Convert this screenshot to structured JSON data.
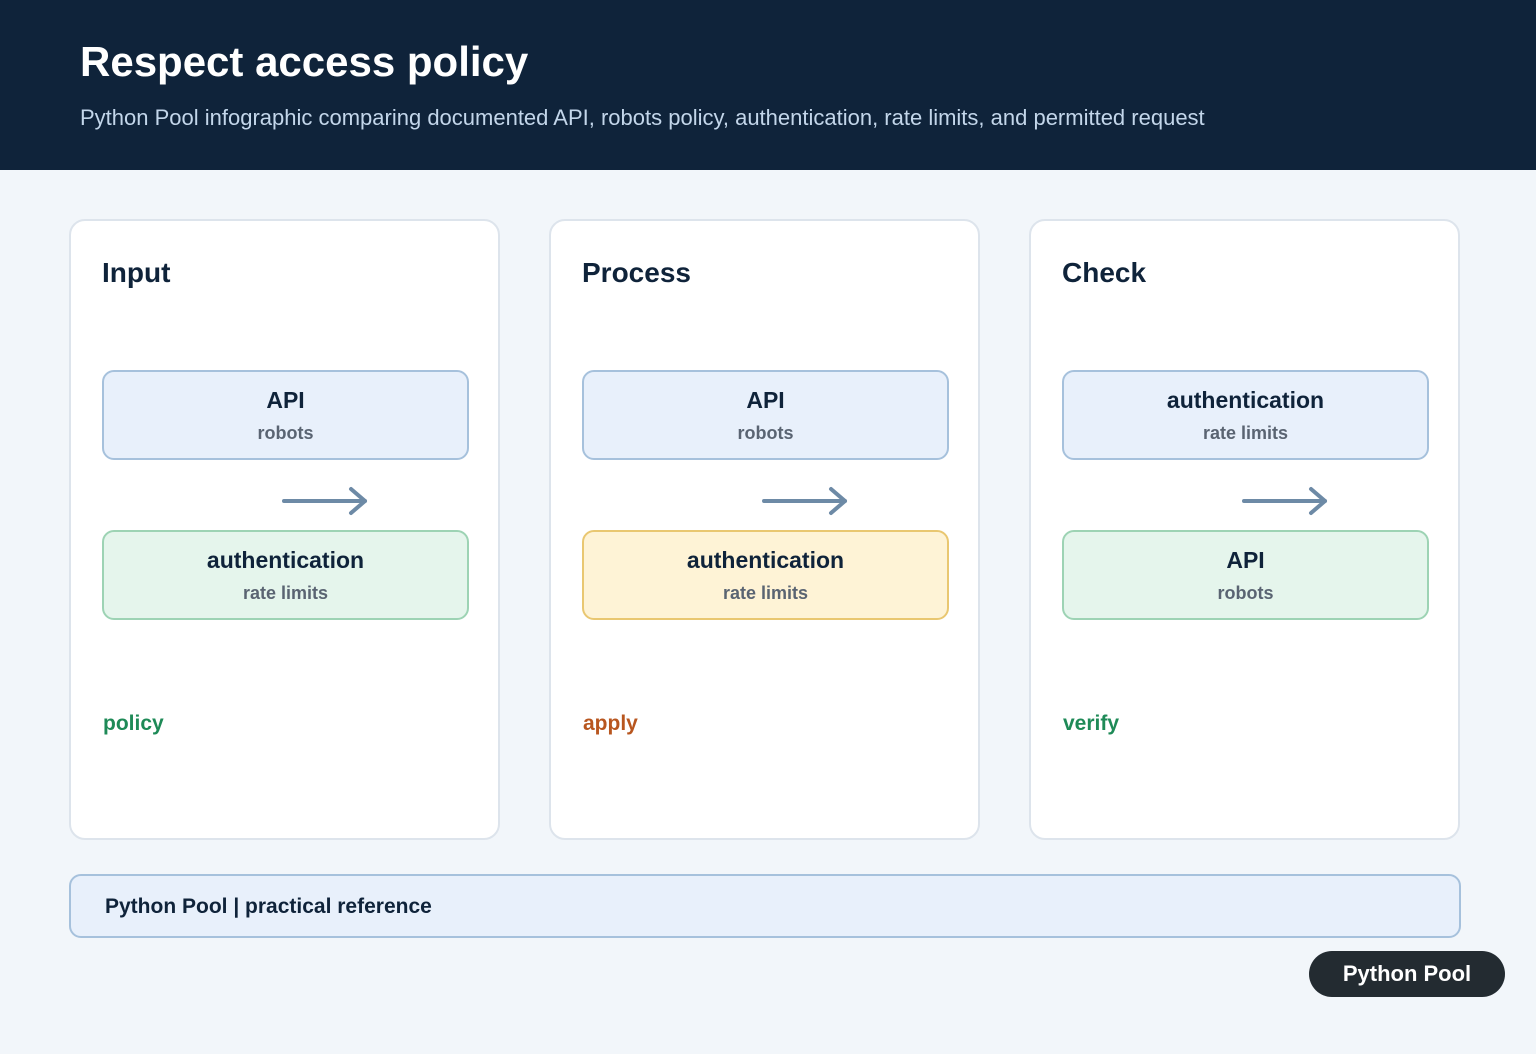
{
  "header": {
    "title": "Respect access policy",
    "subtitle": "Python Pool infographic comparing documented API, robots policy, authentication, rate limits, and permitted request"
  },
  "panels": [
    {
      "title": "Input",
      "top_box": {
        "main": "API",
        "sub": "robots",
        "color": "blue"
      },
      "bottom_box": {
        "main": "authentication",
        "sub": "rate limits",
        "color": "green"
      },
      "tag": "policy",
      "tag_color": "#1e8a57"
    },
    {
      "title": "Process",
      "top_box": {
        "main": "API",
        "sub": "robots",
        "color": "blue"
      },
      "bottom_box": {
        "main": "authentication",
        "sub": "rate limits",
        "color": "yellow"
      },
      "tag": "apply",
      "tag_color": "#b8561f"
    },
    {
      "title": "Check",
      "top_box": {
        "main": "authentication",
        "sub": "rate limits",
        "color": "blue"
      },
      "bottom_box": {
        "main": "API",
        "sub": "robots",
        "color": "green"
      },
      "tag": "verify",
      "tag_color": "#1e8a57"
    }
  ],
  "arrow_icon": "arrow-right-icon",
  "colors": {
    "header_bg": "#0f233a",
    "arrow": "#6d8aa6",
    "blue_box": "#e8f0fb",
    "green_box": "#e5f5ec",
    "yellow_box": "#fef3d6"
  },
  "footer": {
    "label": "Python Pool | practical reference",
    "badge": "Python Pool"
  }
}
